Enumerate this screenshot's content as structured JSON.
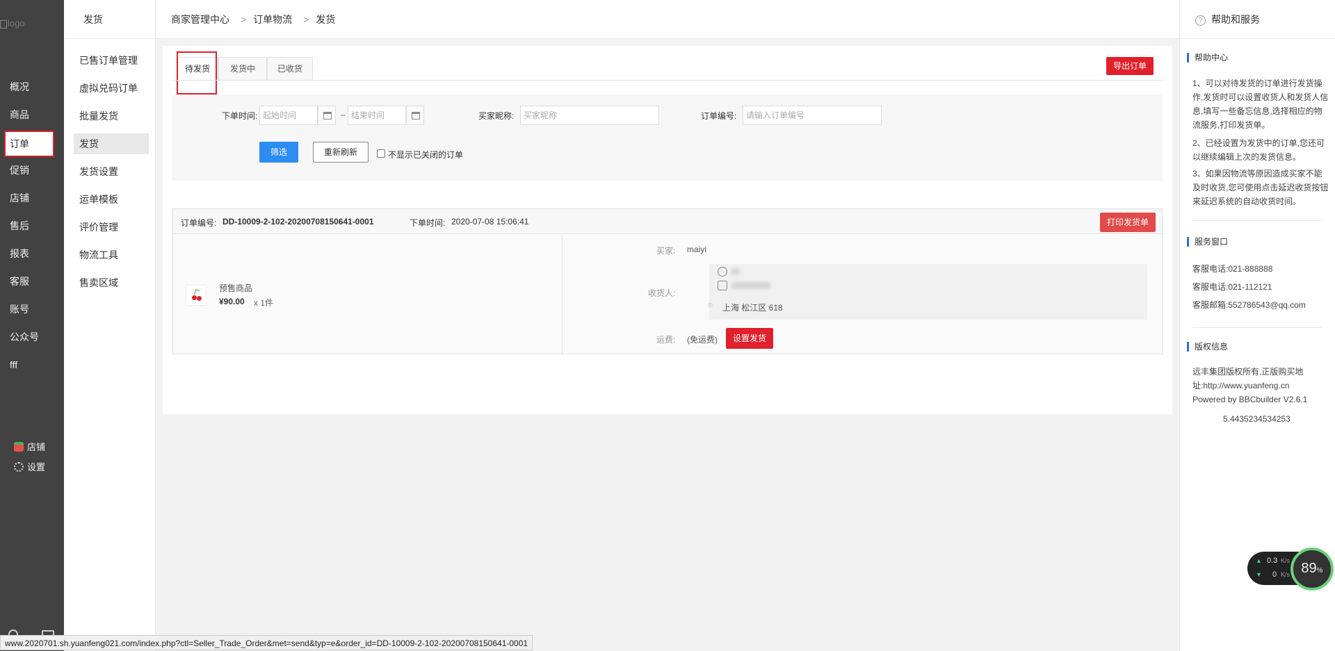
{
  "logo_alt": "logo",
  "left_nav": [
    {
      "label": "概况"
    },
    {
      "label": "商品"
    },
    {
      "label": "订单"
    },
    {
      "label": "促销"
    },
    {
      "label": "店铺"
    },
    {
      "label": "售后"
    },
    {
      "label": "报表"
    },
    {
      "label": "客服"
    },
    {
      "label": "账号"
    },
    {
      "label": "公众号"
    },
    {
      "label": "fff"
    }
  ],
  "left_tools": {
    "shop": "店铺",
    "settings": "设置"
  },
  "sub_nav": {
    "title": "发货",
    "items": [
      "已售订单管理",
      "虚拟兑码订单",
      "批量发货",
      "发货",
      "发货设置",
      "运单模板",
      "评价管理",
      "物流工具",
      "售卖区域"
    ]
  },
  "breadcrumb": [
    "商家管理中心",
    "订单物流",
    "发货"
  ],
  "tabs": [
    "待发货",
    "发货中",
    "已收货"
  ],
  "export_button": "导出订单",
  "filter": {
    "order_time_label": "下单时间:",
    "start_placeholder": "起始时间",
    "end_placeholder": "结束时间",
    "dash": "–",
    "buyer_label": "买家昵称:",
    "buyer_placeholder": "买家昵称",
    "order_no_label": "订单编号:",
    "order_no_placeholder": "请输入订单编号",
    "filter_button": "筛选",
    "reset_button": "重新刷新",
    "hide_closed_label": "不显示已关闭的订单"
  },
  "order": {
    "no_label": "订单编号:",
    "no_value": "DD-10009-2-102-20200708150641-0001",
    "time_label": "下单时间:",
    "time_value": "2020-07-08 15:06:41",
    "print_button": "打印发货单",
    "product_name": "预售商品",
    "price": "¥90.00",
    "qty": "x 1件",
    "buyer_label": "买家:",
    "buyer_value": "maiyi",
    "receiver_label": "收货人:",
    "address": "上海 松江区 618",
    "freight_label": "运费:",
    "freight_value": "(免运费)",
    "ship_button": "设置发货"
  },
  "help": {
    "header": "帮助和服务",
    "center_title": "帮助中心",
    "items": [
      "1、可以对待发货的订单进行发货操作,发货时可以设置收货人和发货人信息,填写一些备忘信息,选择相应的物流服务,打印发货单。",
      "2、已经设置为发货中的订单,您还可以继续编辑上次的发货信息。",
      "3、如果因物流等原因造成买家不能及时收货,您可使用点击延迟收货按钮来延迟系统的自动收货时间。"
    ],
    "service_title": "服务窗口",
    "service": [
      "客服电话:021-888888",
      "客服电话:021-112121",
      "客服邮箱:552786543@qq.com"
    ],
    "copyright_title": "版权信息",
    "copyright": "远丰集团版权所有,正版购买地址:http://www.yuanfeng.cn",
    "powered": "Powered by BBCbuilder V2.6.1",
    "number": "5.4435234534253"
  },
  "net_widget": {
    "up": "0.3",
    "up_unit": "K/s",
    "down": "0",
    "down_unit": "K/s",
    "percent": "89",
    "percent_unit": "%"
  },
  "status_url": "www.2020701.sh.yuanfeng021.com/index.php?ctl=Seller_Trade_Order&met=send&typ=e&order_id=DD-10009-2-102-20200708150641-0001",
  "colors": {
    "accent_red": "#e0202a",
    "blue": "#2d8cf0",
    "sidebar": "#424242"
  }
}
